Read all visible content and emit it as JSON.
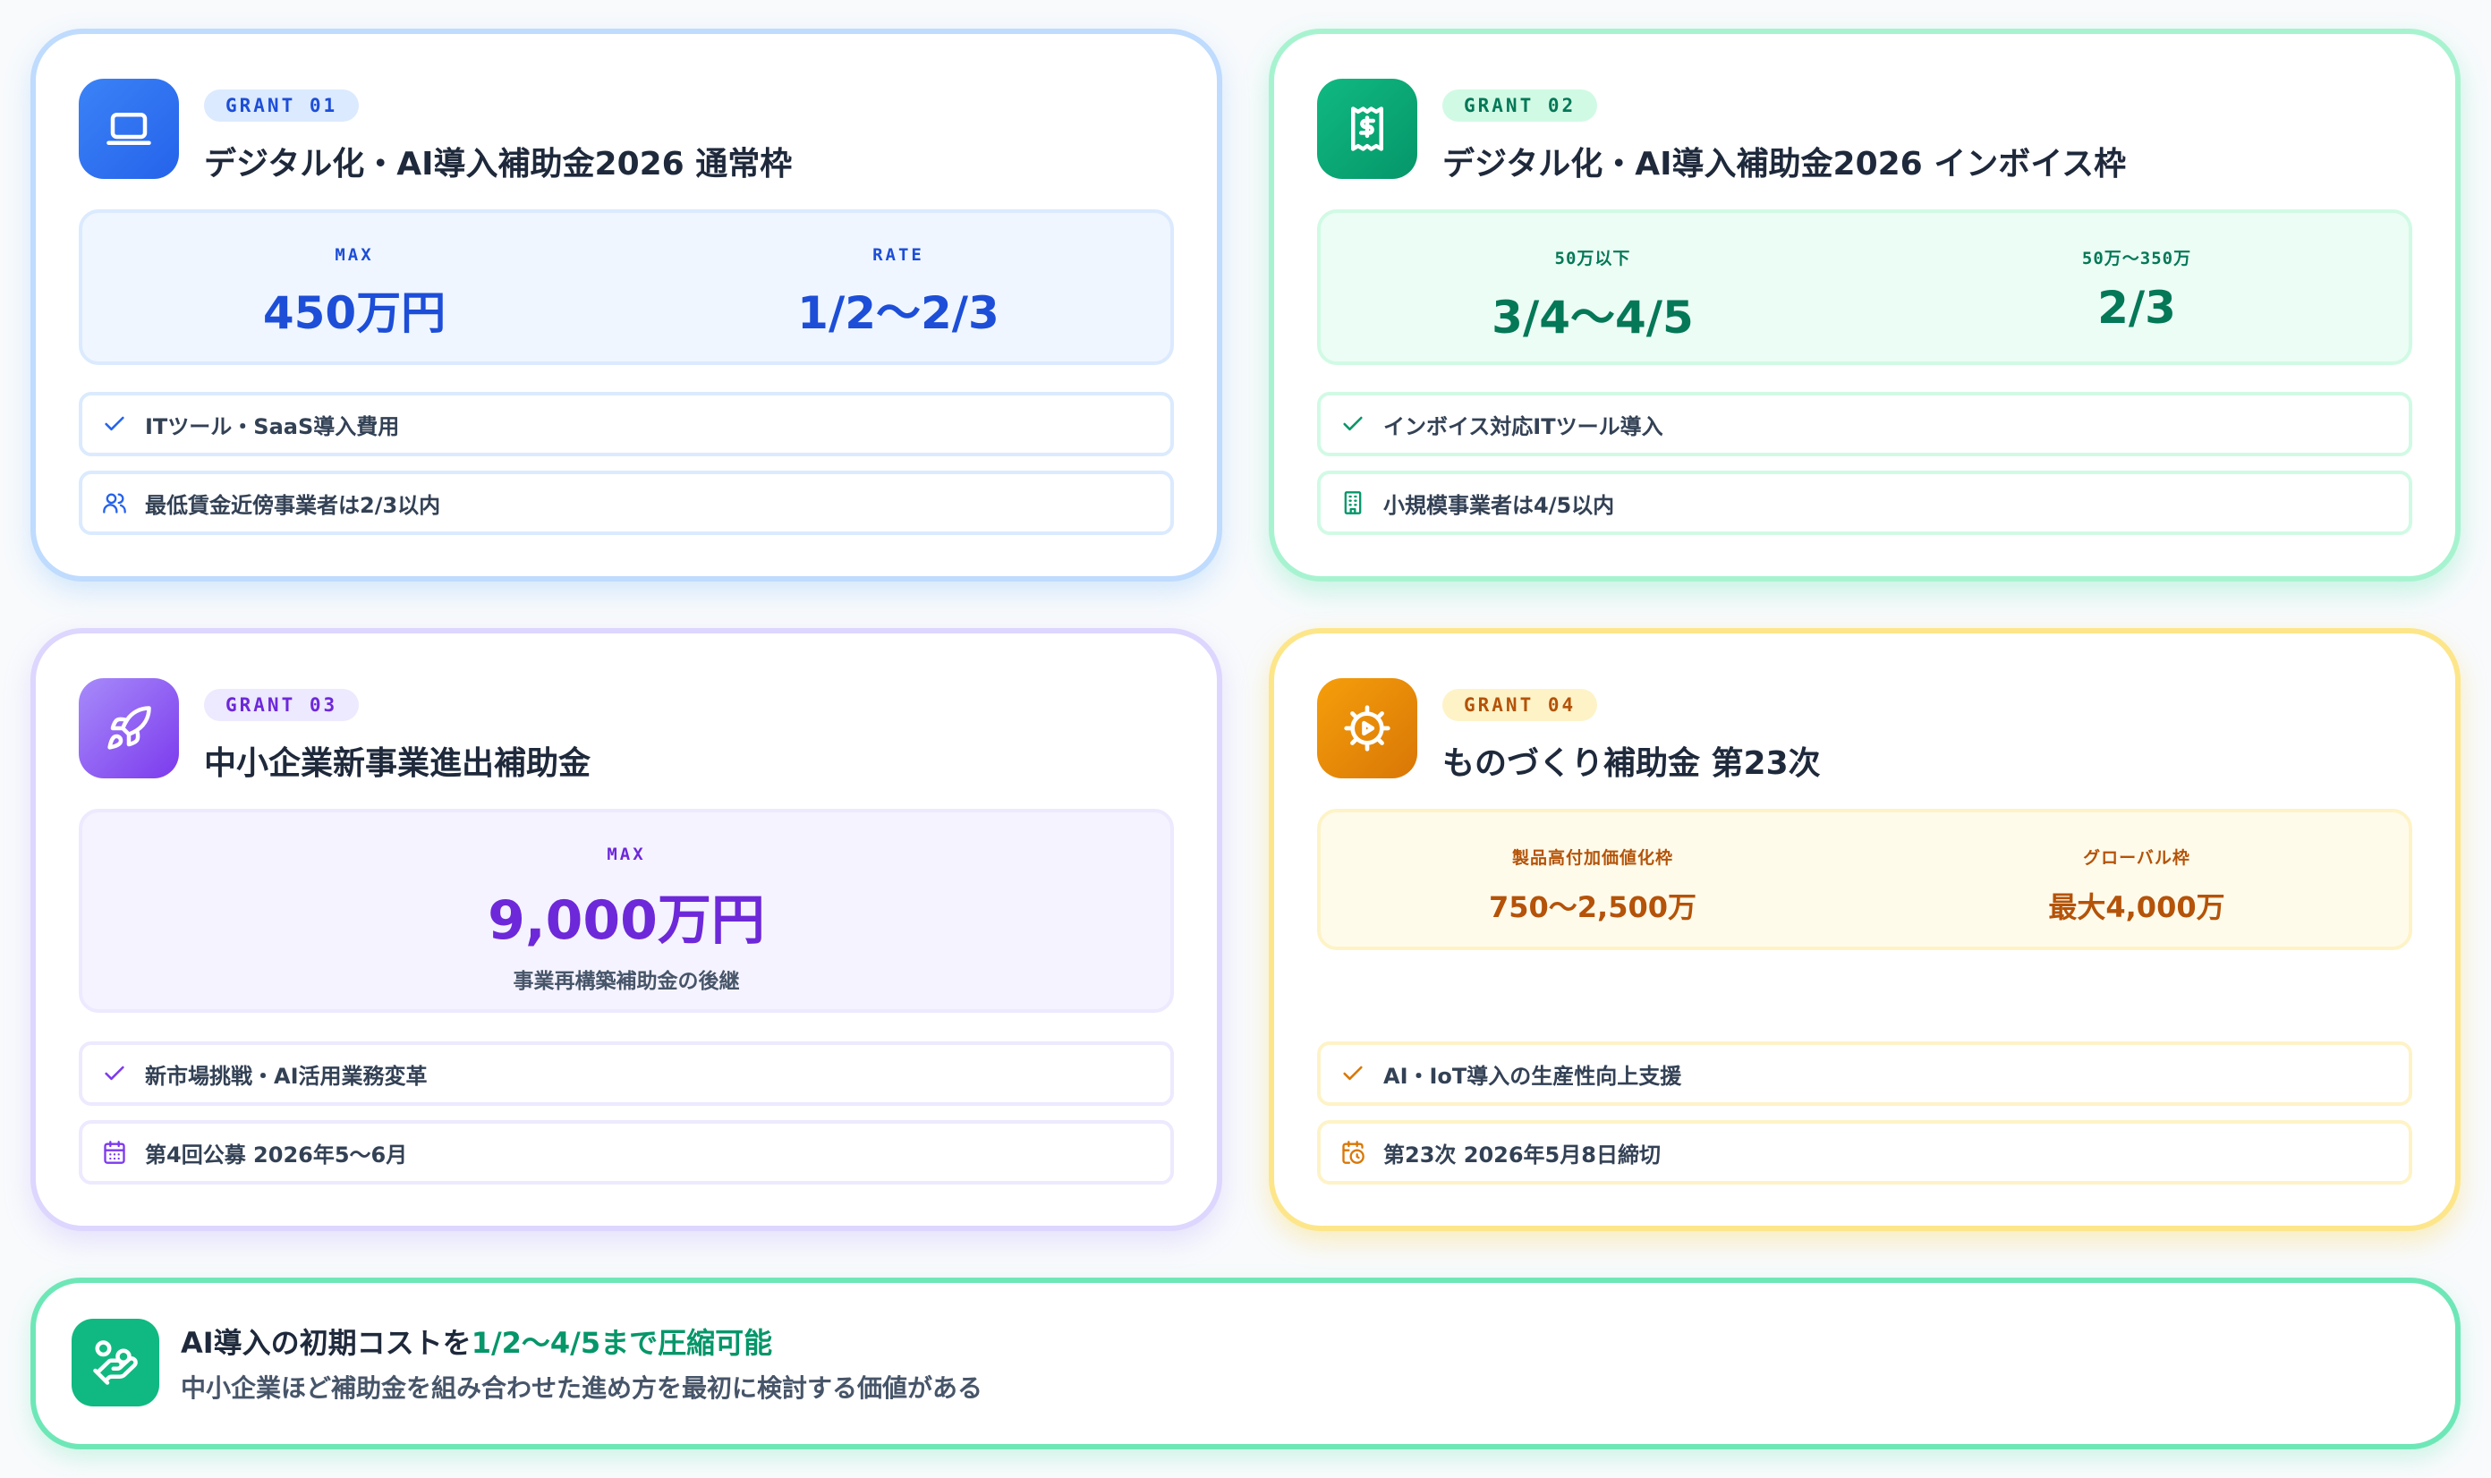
{
  "grants": [
    {
      "badge": "GRANT 01",
      "title": "デジタル化・AI導入補助金2026 通常枠",
      "icon": "laptop-icon",
      "accent": "#3b82f6",
      "stats": [
        {
          "label": "MAX",
          "value": "450万円"
        },
        {
          "label": "RATE",
          "value": "1/2〜2/3"
        }
      ],
      "items": [
        {
          "icon": "check-icon",
          "text": "ITツール・SaaS導入費用"
        },
        {
          "icon": "users-icon",
          "text": "最低賃金近傍事業者は2/3以内"
        }
      ]
    },
    {
      "badge": "GRANT 02",
      "title": "デジタル化・AI導入補助金2026 インボイス枠",
      "icon": "receipt-icon",
      "accent": "#10b981",
      "stats": [
        {
          "label": "50万以下",
          "value": "3/4〜4/5"
        },
        {
          "label": "50万〜350万",
          "value": "2/3"
        }
      ],
      "items": [
        {
          "icon": "check-icon",
          "text": "インボイス対応ITツール導入"
        },
        {
          "icon": "building-icon",
          "text": "小規模事業者は4/5以内"
        }
      ]
    },
    {
      "badge": "GRANT 03",
      "title": "中小企業新事業進出補助金",
      "icon": "rocket-icon",
      "accent": "#8b5cf6",
      "stats": [
        {
          "label": "MAX",
          "value": "9,000万円",
          "sub": "事業再構築補助金の後継"
        }
      ],
      "items": [
        {
          "icon": "check-icon",
          "text": "新市場挑戦・AI活用業務変革"
        },
        {
          "icon": "calendar-icon",
          "text": "第4回公募 2026年5〜6月"
        }
      ]
    },
    {
      "badge": "GRANT 04",
      "title": "ものづくり補助金 第23次",
      "icon": "gear-icon",
      "accent": "#f59e0b",
      "stats": [
        {
          "label": "製品高付加価値化枠",
          "value": "750〜2,500万"
        },
        {
          "label": "グローバル枠",
          "value": "最大4,000万"
        }
      ],
      "items": [
        {
          "icon": "check-icon",
          "text": "AI・IoT導入の生産性向上支援"
        },
        {
          "icon": "calendar-clock-icon",
          "text": "第23次 2026年5月8日締切"
        }
      ]
    }
  ],
  "summary": {
    "icon": "hand-coins-icon",
    "title_prefix": "AI導入の初期コストを",
    "title_highlight": "1/2〜4/5まで圧縮可能",
    "subtitle": "中小企業ほど補助金を組み合わせた進め方を最初に検討する価値がある"
  }
}
